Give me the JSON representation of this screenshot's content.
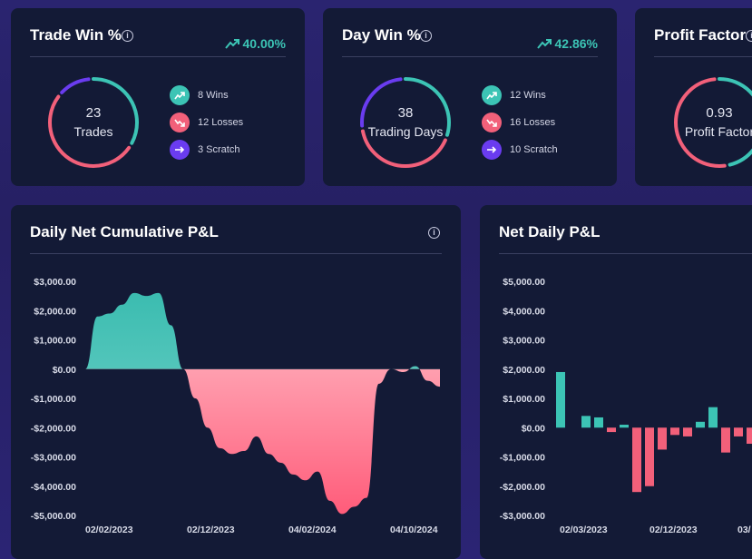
{
  "colors": {
    "win": "#3cc4b5",
    "loss": "#f2607a",
    "scratch": "#6a3cf0",
    "card": "#131a36"
  },
  "stat_cards": [
    {
      "title": "Trade Win %",
      "trend_value": "40.00%",
      "center_value": "23",
      "center_label": "Trades",
      "wins": "8 Wins",
      "losses": "12 Losses",
      "scratch": "3 Scratch",
      "ring": {
        "win": 8,
        "loss": 12,
        "scratch": 3
      }
    },
    {
      "title": "Day Win %",
      "trend_value": "42.86%",
      "center_value": "38",
      "center_label": "Trading Days",
      "wins": "12 Wins",
      "losses": "16 Losses",
      "scratch": "10 Scratch",
      "ring": {
        "win": 12,
        "loss": 16,
        "scratch": 10
      }
    },
    {
      "title": "Profit Factor",
      "center_value": "0.93",
      "center_label": "Profit Factor",
      "ring": {
        "win": 48,
        "loss": 52,
        "scratch": 0
      }
    }
  ],
  "chart_data": [
    {
      "type": "area",
      "title": "Daily Net Cumulative P&L",
      "y_ticks": [
        "$3,000.00",
        "$2,000.00",
        "$1,000.00",
        "$0.00",
        "-$1,000.00",
        "-$2,000.00",
        "-$3,000.00",
        "-$4,000.00",
        "-$5,000.00"
      ],
      "x_ticks": [
        "02/02/2023",
        "02/12/2023",
        "04/02/2024",
        "04/10/2024"
      ],
      "ylim": [
        -5000,
        3000
      ],
      "values": [
        0,
        1800,
        1900,
        2200,
        2600,
        2500,
        2600,
        1500,
        0,
        -1000,
        -2000,
        -2700,
        -2900,
        -2800,
        -2300,
        -2900,
        -3200,
        -3600,
        -3800,
        -3500,
        -4500,
        -4950,
        -4700,
        -4400,
        -500,
        0,
        -100,
        100,
        -400,
        -600
      ]
    },
    {
      "type": "bar",
      "title": "Net Daily P&L",
      "y_ticks": [
        "$5,000.00",
        "$4,000.00",
        "$3,000.00",
        "$2,000.00",
        "$1,000.00",
        "$0.00",
        "-$1,000.00",
        "-$2,000.00",
        "-$3,000.00"
      ],
      "x_ticks": [
        "02/03/2023",
        "02/12/2023",
        "03/"
      ],
      "ylim": [
        -3000,
        5000
      ],
      "values": [
        1900,
        0,
        400,
        350,
        -150,
        100,
        -2200,
        -2000,
        -750,
        -250,
        -300,
        200,
        700,
        -850,
        -300,
        -550
      ]
    }
  ]
}
